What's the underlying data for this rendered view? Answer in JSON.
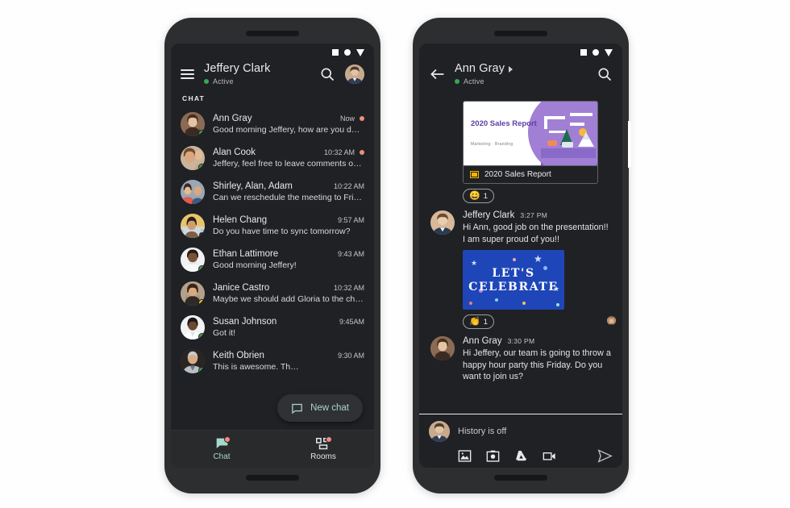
{
  "status_bar": {
    "icons": [
      "square-icon",
      "circle-icon",
      "triangle-down-icon"
    ]
  },
  "left_phone": {
    "app_bar": {
      "menu_icon": "hamburger-menu-icon",
      "title": "Jeffery Clark",
      "presence": "Active",
      "search_icon": "search-icon",
      "avatar": "user-avatar"
    },
    "section_label": "CHAT",
    "conversations": [
      {
        "name": "Ann Gray",
        "time": "Now",
        "preview": "Good morning Jeffery, how are you doing?",
        "unread": true,
        "presence": "on"
      },
      {
        "name": "Alan Cook",
        "time": "10:32 AM",
        "preview": "Jeffery, feel free to leave comments on t…",
        "unread": true,
        "presence": "on"
      },
      {
        "name": "Shirley, Alan, Adam",
        "time": "10:22 AM",
        "preview": "Can we reschedule the meeting to Friday?",
        "unread": false,
        "presence": "none"
      },
      {
        "name": "Helen Chang",
        "time": "9:57 AM",
        "preview": "Do you have time to sync tomorrow?",
        "unread": false,
        "presence": "off"
      },
      {
        "name": "Ethan Lattimore",
        "time": "9:43 AM",
        "preview": "Good morning Jeffery!",
        "unread": false,
        "presence": "on"
      },
      {
        "name": "Janice Castro",
        "time": "10:32 AM",
        "preview": "Maybe we should add Gloria to the chat…",
        "unread": false,
        "presence": "away"
      },
      {
        "name": "Susan Johnson",
        "time": "9:45AM",
        "preview": "Got it!",
        "unread": false,
        "presence": "on"
      },
      {
        "name": "Keith Obrien",
        "time": "9:30 AM",
        "preview": "This is awesome. Th…",
        "unread": false,
        "presence": "on"
      }
    ],
    "fab": {
      "label": "New chat",
      "icon": "chat-bubble-icon"
    },
    "bottom_nav": [
      {
        "label": "Chat",
        "icon": "chat-bubble-icon",
        "active": true,
        "has_badge": true
      },
      {
        "label": "Rooms",
        "icon": "rooms-grid-icon",
        "active": false,
        "has_badge": true
      }
    ]
  },
  "right_phone": {
    "app_bar": {
      "back_icon": "back-arrow-icon",
      "title": "Ann Gray",
      "caret_icon": "caret-right-icon",
      "presence": "Active",
      "search_icon": "search-icon"
    },
    "attachment_card": {
      "slide_title": "2020 Sales Report",
      "slide_subtitle": "Marketing · Branding",
      "file_icon": "google-slides-icon",
      "file_name": "2020 Sales Report"
    },
    "reactions": [
      {
        "emoji": "😀",
        "count": "1"
      },
      {
        "emoji": "👏",
        "count": "1"
      }
    ],
    "messages": [
      {
        "name": "Jeffery Clark",
        "time": "3:27 PM",
        "text": "Hi Ann, good job on the presentation!! I am super proud of you!!",
        "image": {
          "line1": "LET'S",
          "line2": "CELEBRATE"
        }
      },
      {
        "name": "Ann Gray",
        "time": "3:30 PM",
        "text": "Hi Jeffery, our team is going to throw a happy hour party this Friday. Do you want to join us?",
        "image": null
      }
    ],
    "compose": {
      "placeholder": "History is off",
      "avatar": "user-avatar",
      "icons": [
        "image-icon",
        "camera-icon",
        "google-drive-icon",
        "video-icon"
      ],
      "send_icon": "send-icon"
    }
  },
  "colors": {
    "screen_bg": "#202124",
    "accent_teal": "#a7d7cd",
    "unread_dot": "#f28b82",
    "presence_green": "#34a853",
    "presence_away": "#e8c51b"
  }
}
